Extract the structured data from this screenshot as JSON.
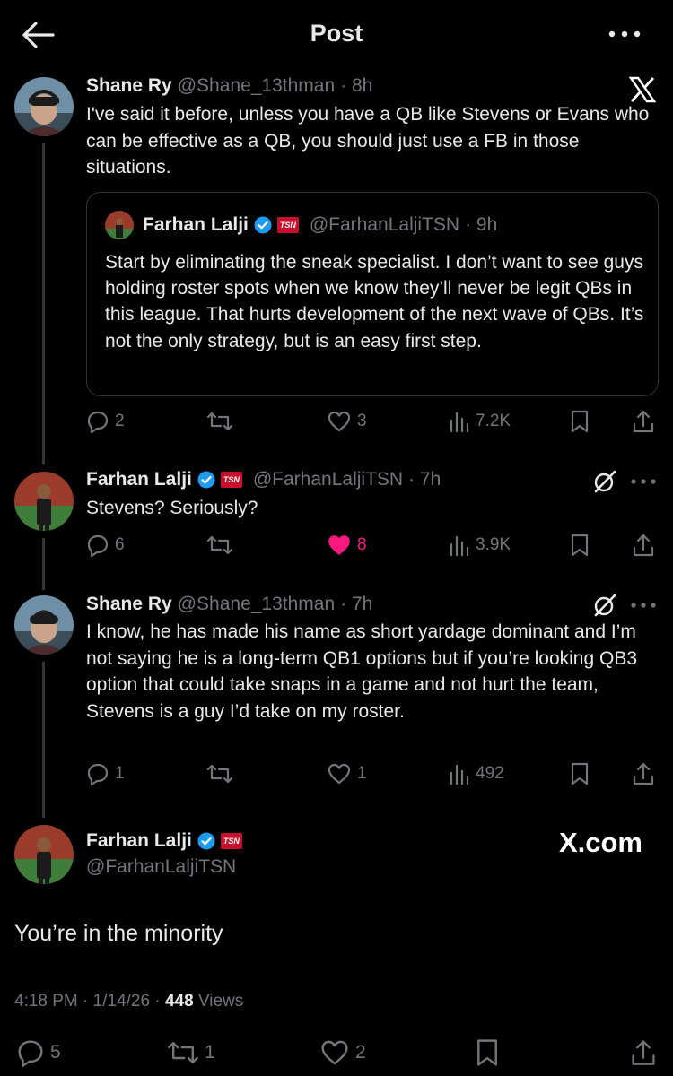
{
  "header": {
    "title": "Post"
  },
  "tweets": [
    {
      "name": "Shane Ry",
      "handle": "@Shane_13thman",
      "time": "· 8h",
      "text": "I've said it before, unless you have a QB like Stevens or Evans who can be effective as a QB, you should just use a FB in those situations.",
      "quote": {
        "name": "Farhan Lalji",
        "badge": "TSN",
        "handle": "@FarhanLaljiTSN",
        "time": "· 9h",
        "text": "Start by eliminating the sneak specialist. I don’t want to see guys holding roster spots when we know they’ll never be legit QBs in this league. That hurts development of the next wave of QBs. It’s not the only strategy, but is an easy first step."
      },
      "replies": "2",
      "reposts": "",
      "likes": "3",
      "views": "7.2K"
    },
    {
      "name": "Farhan Lalji",
      "badge": "TSN",
      "handle": "@FarhanLaljiTSN",
      "time": "· 7h",
      "text": "Stevens? Seriously?",
      "replies": "6",
      "reposts": "",
      "likes": "8",
      "views": "3.9K"
    },
    {
      "name": "Shane Ry",
      "handle": "@Shane_13thman",
      "time": "· 7h",
      "text": "I know, he has made his name as short yardage dominant and I’m not saying he is a long-term QB1 options but if you’re looking QB3 option that could take snaps in a game and not hurt the team, Stevens is a guy I’d take on my roster.",
      "replies": "1",
      "reposts": "",
      "likes": "1",
      "views": "492"
    }
  ],
  "main": {
    "name": "Farhan Lalji",
    "badge": "TSN",
    "handle": "@FarhanLaljiTSN",
    "watermark": "X.com",
    "text": "You’re in the minority",
    "time": "4:18 PM",
    "date": "1/14/26",
    "views_count": "448",
    "views_label": "Views",
    "replies": "5",
    "reposts": "1",
    "likes": "2"
  },
  "colors": {
    "background": "#000000",
    "text": "#e7e9ea",
    "muted": "#71767b",
    "like_active": "#f91880",
    "verified": "#1d9bf0",
    "tsn": "#c8102e"
  }
}
